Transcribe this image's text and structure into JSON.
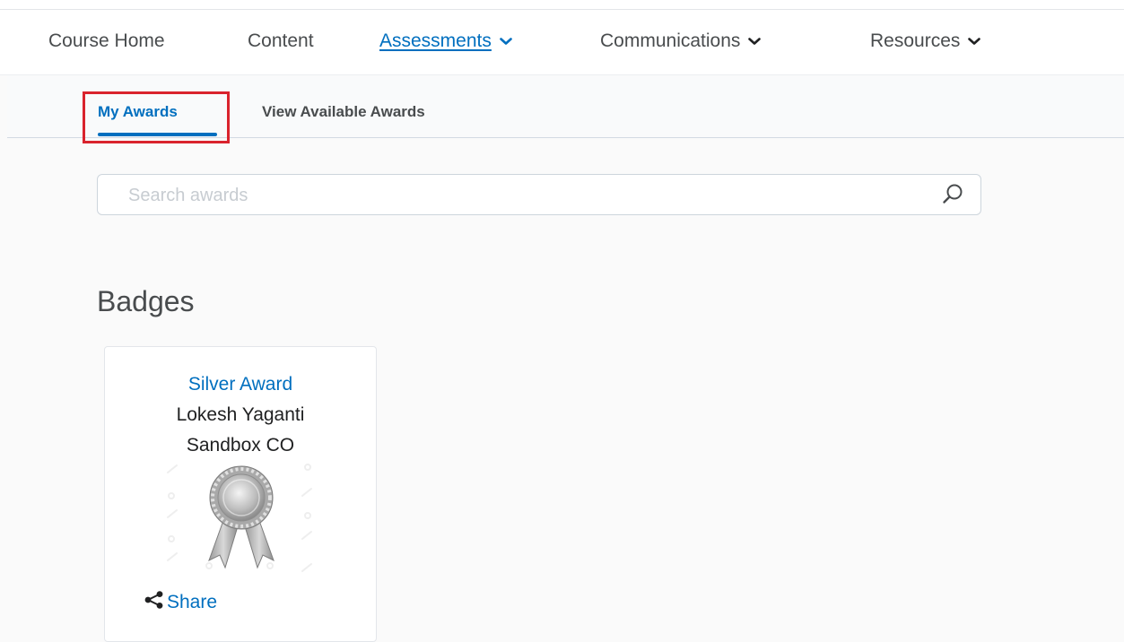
{
  "nav": {
    "items": [
      {
        "label": "Course Home",
        "dropdown": false,
        "active": false
      },
      {
        "label": "Content",
        "dropdown": false,
        "active": false
      },
      {
        "label": "Assessments",
        "dropdown": true,
        "active": true
      },
      {
        "label": "Communications",
        "dropdown": true,
        "active": false
      },
      {
        "label": "Resources",
        "dropdown": true,
        "active": false
      }
    ]
  },
  "subnav": {
    "tabs": [
      {
        "label": "My Awards",
        "active": true
      },
      {
        "label": "View Available Awards",
        "active": false
      }
    ]
  },
  "search": {
    "placeholder": "Search awards",
    "value": "",
    "icon": "search-icon"
  },
  "section": {
    "heading": "Badges"
  },
  "award": {
    "title": "Silver Award",
    "recipient": "Lokesh Yaganti",
    "course": "Sandbox CO",
    "image": "silver-ribbon-badge",
    "share_label": "Share",
    "share_icon": "share-icon"
  },
  "colors": {
    "link": "#006fbf",
    "highlight": "#d9232d",
    "text": "#494c4e"
  }
}
